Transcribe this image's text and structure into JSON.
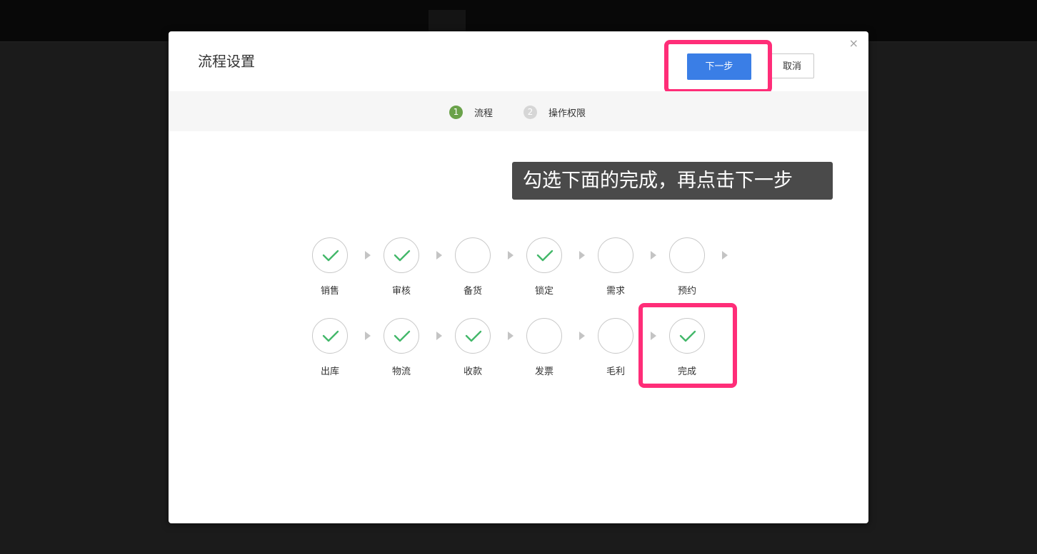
{
  "modal": {
    "title": "流程设置",
    "close_glyph": "×",
    "next_label": "下一步",
    "cancel_label": "取消",
    "accent_color": "#3a7ee6",
    "highlight_color": "#ff2d78"
  },
  "steps": [
    {
      "num": "1",
      "label": "流程",
      "active": true
    },
    {
      "num": "2",
      "label": "操作权限",
      "active": false
    }
  ],
  "tooltip": "勾选下面的完成，再点击下一步",
  "flow_rows": [
    [
      {
        "label": "销售",
        "checked": true
      },
      {
        "label": "审核",
        "checked": true
      },
      {
        "label": "备货",
        "checked": false
      },
      {
        "label": "锁定",
        "checked": true
      },
      {
        "label": "需求",
        "checked": false
      },
      {
        "label": "预约",
        "checked": false
      }
    ],
    [
      {
        "label": "出库",
        "checked": true
      },
      {
        "label": "物流",
        "checked": true
      },
      {
        "label": "收款",
        "checked": true
      },
      {
        "label": "发票",
        "checked": false
      },
      {
        "label": "毛利",
        "checked": false
      },
      {
        "label": "完成",
        "checked": true
      }
    ]
  ],
  "icons": {
    "check": "check-icon",
    "arrow": "arrow-right-icon",
    "close": "close-icon"
  }
}
